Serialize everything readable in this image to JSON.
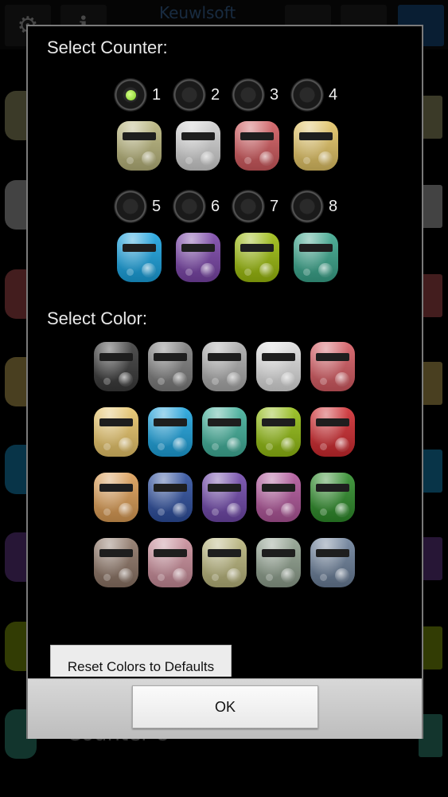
{
  "app": {
    "title": "Keuwlsoft",
    "counter_label": "Counter 8"
  },
  "dialog": {
    "select_counter_label": "Select Counter:",
    "select_color_label": "Select Color:",
    "counters": [
      {
        "num": "1",
        "color": "#b9b57c",
        "selected": true
      },
      {
        "num": "2",
        "color": "#d2d2d2",
        "selected": false
      },
      {
        "num": "3",
        "color": "#d05a5e",
        "selected": false
      },
      {
        "num": "4",
        "color": "#e3c465",
        "selected": false
      },
      {
        "num": "5",
        "color": "#1aa3e0",
        "selected": false
      },
      {
        "num": "6",
        "color": "#7a45a8",
        "selected": false
      },
      {
        "num": "7",
        "color": "#9cbc0d",
        "selected": false
      },
      {
        "num": "8",
        "color": "#3aa68c",
        "selected": false
      }
    ],
    "colors": [
      "#3a3a3a",
      "#7d7d7d",
      "#acacac",
      "#dedede",
      "#d55b62",
      "#e8c56a",
      "#1ea3dd",
      "#41b09a",
      "#93bd13",
      "#cf2a2f",
      "#dc9d55",
      "#2e4f9e",
      "#7048aa",
      "#b0569a",
      "#2e8c2a",
      "#8d7566",
      "#c98d9a",
      "#b9b57c",
      "#8fa08e",
      "#6b7f99"
    ],
    "reset_label": "Reset Colors to Defaults",
    "ok_label": "OK"
  }
}
